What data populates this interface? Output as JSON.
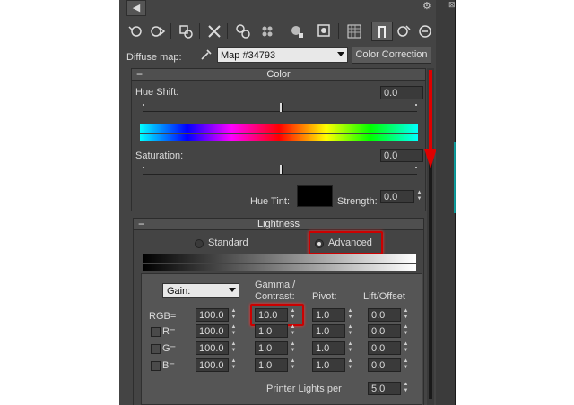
{
  "colors": {
    "panel_bg": "#444444",
    "highlight": "#cc0000",
    "arrow": "#e00000"
  },
  "titlebar": {
    "left_arrow": "◀",
    "right_icon": "⚙"
  },
  "toolbar": {
    "icons": [
      "pick-material-icon",
      "put-to-scene-icon",
      "assign-to-selection-icon",
      "reset-map-icon",
      "make-unique-icon",
      "put-to-library-icon",
      "material-id-icon",
      "show-map-in-viewport-icon",
      "show-end-result-icon",
      "go-to-parent-icon",
      "go-forward-to-sibling-icon",
      "background-icon"
    ]
  },
  "diffuse": {
    "label": "Diffuse map:",
    "map_name": "Map #34793",
    "type_button": "Color Correction"
  },
  "color": {
    "title": "Color",
    "hue_shift_label": "Hue Shift:",
    "hue_shift_value": "0.0",
    "saturation_label": "Saturation:",
    "saturation_value": "0.0",
    "hue_tint_label": "Hue Tint:",
    "strength_label": "Strength:",
    "strength_value": "0.0"
  },
  "lightness": {
    "title": "Lightness",
    "standard_label": "Standard",
    "advanced_label": "Advanced",
    "gain_option": "Gain:",
    "col_gamma": "Gamma /",
    "col_contrast": "Contrast:",
    "col_pivot": "Pivot:",
    "col_lift": "Lift/Offset",
    "rows": [
      {
        "label": "RGB=",
        "gain": "100.0",
        "gamma": "10.0",
        "pivot": "1.0",
        "lift": "0.0"
      },
      {
        "label": "R=",
        "gain": "100.0",
        "gamma": "1.0",
        "pivot": "1.0",
        "lift": "0.0"
      },
      {
        "label": "G=",
        "gain": "100.0",
        "gamma": "1.0",
        "pivot": "1.0",
        "lift": "0.0"
      },
      {
        "label": "B=",
        "gain": "100.0",
        "gamma": "1.0",
        "pivot": "1.0",
        "lift": "0.0"
      }
    ],
    "printer_label": "Printer Lights per",
    "printer_value": "5.0"
  }
}
